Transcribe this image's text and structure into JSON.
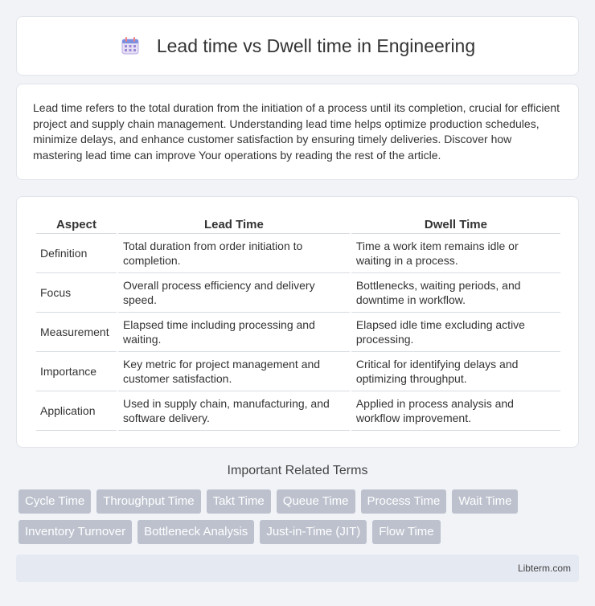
{
  "header": {
    "title": "Lead time vs Dwell time in Engineering",
    "icon": "calendar-icon"
  },
  "intro": {
    "text": "Lead time refers to the total duration from the initiation of a process until its completion, crucial for efficient project and supply chain management. Understanding lead time helps optimize production schedules, minimize delays, and enhance customer satisfaction by ensuring timely deliveries. Discover how mastering lead time can improve Your operations by reading the rest of the article."
  },
  "table": {
    "headers": [
      "Aspect",
      "Lead Time",
      "Dwell Time"
    ],
    "rows": [
      [
        "Definition",
        "Total duration from order initiation to completion.",
        "Time a work item remains idle or waiting in a process."
      ],
      [
        "Focus",
        "Overall process efficiency and delivery speed.",
        "Bottlenecks, waiting periods, and downtime in workflow."
      ],
      [
        "Measurement",
        "Elapsed time including processing and waiting.",
        "Elapsed idle time excluding active processing."
      ],
      [
        "Importance",
        "Key metric for project management and customer satisfaction.",
        "Critical for identifying delays and optimizing throughput."
      ],
      [
        "Application",
        "Used in supply chain, manufacturing, and software delivery.",
        "Applied in process analysis and workflow improvement."
      ]
    ]
  },
  "related": {
    "title": "Important Related Terms",
    "tags": [
      "Cycle Time",
      "Throughput Time",
      "Takt Time",
      "Queue Time",
      "Process Time",
      "Wait Time",
      "Inventory Turnover",
      "Bottleneck Analysis",
      "Just-in-Time (JIT)",
      "Flow Time"
    ]
  },
  "footer": {
    "site": "Libterm.com"
  },
  "colors": {
    "tag_bg": "#bcc1cd",
    "footer_bg": "#e5e9f2",
    "page_bg": "#f1f3f7"
  }
}
